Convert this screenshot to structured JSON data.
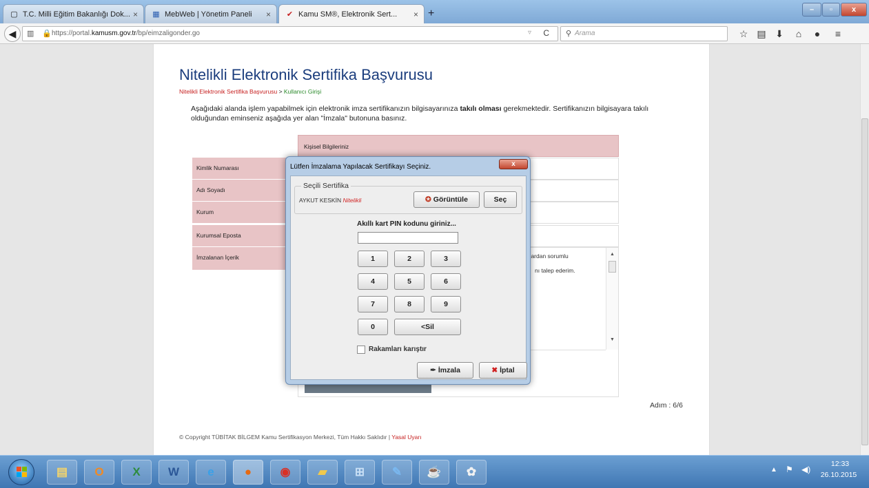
{
  "browser": {
    "tabs": [
      {
        "title": "T.C. Milli Eğitim Bakanlığı Dok...",
        "icon": "document-icon"
      },
      {
        "title": "MebWeb | Yönetim Paneli",
        "icon": "grid-icon"
      },
      {
        "title": "Kamu SM®, Elektronik Sert...",
        "icon": "kamusm-icon",
        "active": true
      }
    ],
    "tab_close": "×",
    "new_tab": "+",
    "url_prefix": "https://portal.",
    "url_host": "kamusm.gov.tr",
    "url_path": "/bp/eimzaligonder.go",
    "search_placeholder": "Arama"
  },
  "page": {
    "title": "Nitelikli Elektronik Sertifika Başvurusu",
    "breadcrumb_1": "Nitelikli Elektronik Sertifika Başvurusu",
    "breadcrumb_sep": " > ",
    "breadcrumb_2": "Kullanıcı Girişi",
    "intro_1": "Aşağıdaki alanda işlem yapabilmek için elektronik imza sertifikanızın bilgisayarınıza ",
    "intro_bold": "takılı olması",
    "intro_2": " gerekmektedir. Sertifikanızın bilgisayara takılı olduğundan eminseniz aşağıda yer alan \"İmzala\" butonuna basınız.",
    "personal_header": "Kişisel Bilgileriniz",
    "fields": [
      "Kimlik Numarası",
      "Adı Soyadı",
      "Kurum",
      "Kurumsal Eposta",
      "İmzalanan İçerik"
    ],
    "content_fragment_1": "arlardan sorumlu",
    "content_fragment_2": "nı talep ederim.",
    "step": "Adım : 6/6",
    "copyright": "© Copyright TÜBİTAK BİLGEM Kamu Sertifikasyon Merkezi, Tüm Hakkı Saklıdır | ",
    "legal_link": "Yasal Uyarı"
  },
  "dialog": {
    "title": "Lütfen İmzalama Yapılacak Sertifikayı Seçiniz.",
    "close": "x",
    "group_title": "Seçili Sertifika",
    "cert_name": "AYKUT KESKİN ",
    "cert_type": "Nitelikli",
    "view_button": "Görüntüle",
    "select_button": "Seç",
    "pin_label": "Akıllı kart PIN kodunu giriniz...",
    "pin_value": "",
    "keys": [
      [
        "1",
        "2",
        "3"
      ],
      [
        "4",
        "5",
        "6"
      ],
      [
        "7",
        "8",
        "9"
      ]
    ],
    "key_zero": "0",
    "delete_button": "<Sil",
    "shuffle_label": "Rakamları karıştır",
    "shuffle_checked": false,
    "sign_button": "İmzala",
    "cancel_button": "İptal"
  },
  "taskbar": {
    "apps": [
      "windows-explorer-icon",
      "outlook-icon",
      "excel-icon",
      "word-icon",
      "internet-explorer-icon",
      "firefox-icon",
      "chrome-icon",
      "folder-icon",
      "network-icon",
      "notepad-icon",
      "java-icon",
      "paint-icon"
    ],
    "time": "12:33",
    "date": "26.10.2015"
  },
  "colors": {
    "title_blue": "#1b3d7d",
    "field_pink": "#e8c4c6",
    "breadcrumb_red": "#c62020",
    "breadcrumb_green": "#2a8a2a",
    "dialog_frame": "#b6cde6"
  }
}
